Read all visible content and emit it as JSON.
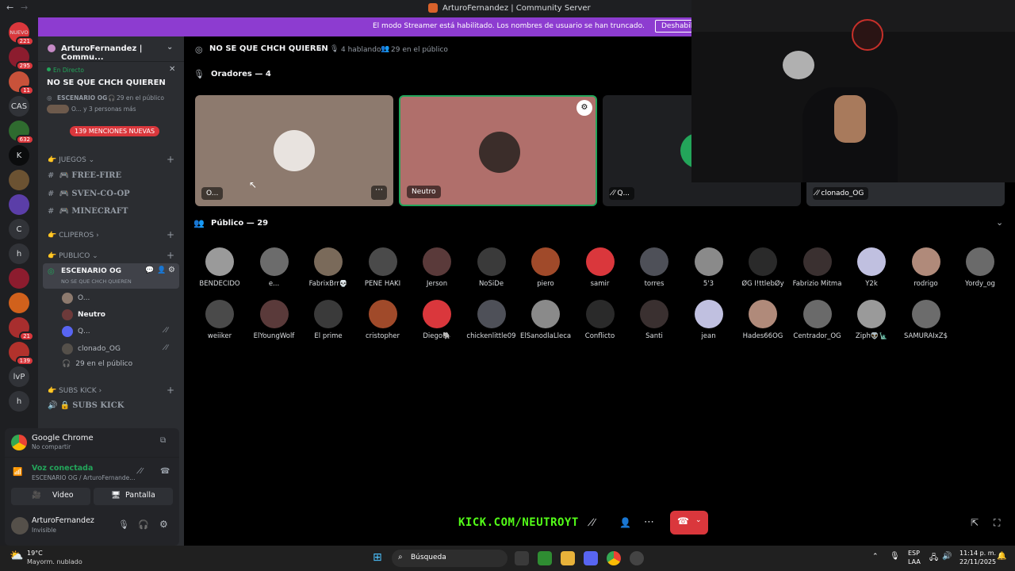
{
  "window": {
    "title": "ArturoFernandez | Community Server"
  },
  "banner": {
    "text": "El modo Streamer está habilitado. Los nombres de usuario se han truncado.",
    "button": "Deshabilitar"
  },
  "rail": {
    "items": [
      {
        "label": "NUEVO",
        "badge": "221",
        "color": "#da373c"
      },
      {
        "label": "",
        "badge": "295",
        "color": "#8c1c2e"
      },
      {
        "label": "",
        "badge": "11",
        "color": "#c8523a"
      },
      {
        "label": "CAS",
        "badge": "",
        "color": "#313338"
      },
      {
        "label": "",
        "badge": "632",
        "color": "#2f6b2f"
      },
      {
        "label": "K",
        "badge": "",
        "color": "#0b0c0d"
      },
      {
        "label": "",
        "badge": "",
        "color": "#6b5232"
      },
      {
        "label": "",
        "badge": "",
        "color": "#5b3ea8"
      },
      {
        "label": "C",
        "badge": "",
        "color": "#313338"
      },
      {
        "label": "h",
        "badge": "",
        "color": "#313338"
      },
      {
        "label": "",
        "badge": "",
        "color": "#8c1c2e"
      },
      {
        "label": "",
        "badge": "",
        "color": "#d1611c"
      },
      {
        "label": "",
        "badge": "21",
        "color": "#a82e2e"
      },
      {
        "label": "",
        "badge": "139",
        "color": "#b2322c"
      },
      {
        "label": "lvP",
        "badge": "",
        "color": "#313338"
      },
      {
        "label": "h",
        "badge": "",
        "color": "#313338"
      }
    ]
  },
  "sidebar": {
    "server_name": "ArturoFernandez | Commu...",
    "live": {
      "status": "En Directo",
      "title": "NO SE QUE CHCH QUIEREN",
      "stage": "ESCENARIO OG",
      "audience": "29 en el público",
      "others": "O... y 3 personas más"
    },
    "mentions_badge": "139 MENCIONES NUEVAS",
    "categories": [
      {
        "name": "JUEGOS",
        "channels": [
          "FREE-FIRE",
          "SVEN-CO-OP",
          "MINECRAFT"
        ]
      },
      {
        "name": "CLIPEROS",
        "channels": []
      },
      {
        "name": "PUBLICO",
        "channels": []
      }
    ],
    "stage_channel": {
      "name": "ESCENARIO OG",
      "topic": "NO SE QUE CHCH QUIEREN"
    },
    "stage_users": [
      "O...",
      "Neutro",
      "Q...",
      "clonado_OG"
    ],
    "stage_audience": "29 en el público",
    "subs_category": "SUBS KICK",
    "subs_channel": "SUBS KICK"
  },
  "activity": {
    "app": "Google Chrome",
    "status": "No compartir"
  },
  "voice": {
    "status": "Voz conectada",
    "location": "ESCENARIO OG / ArturoFernande...",
    "video_btn": "Video",
    "screen_btn": "Pantalla"
  },
  "user": {
    "name": "ArturoFernandez",
    "status": "Invisible"
  },
  "main": {
    "stage_title": "NO SE QUE CHCH QUIEREN",
    "speaking": "4 hablando",
    "public_count": "29 en el público",
    "speakers_header": "Oradores — 4",
    "speakers": [
      {
        "name": "O...",
        "bg": "#8d7a6e"
      },
      {
        "name": "Neutro",
        "bg": "#b06f6b"
      },
      {
        "name": "Q...",
        "bg": "#1e1f22"
      },
      {
        "name": "clonado_OG",
        "bg": "#2b2d31"
      }
    ],
    "public_header": "Público — 29",
    "audience_row1": [
      "BENDECIDO",
      "e...",
      "FabrixBrr💀",
      "PENE HAKI",
      "Jerson",
      "NoSiDe",
      "piero",
      "samir",
      "torres",
      "5'3",
      "ØG I!ttlebØy",
      "Fabrizio Mitma",
      "Y2k",
      "rodrigo",
      "Yordy_og"
    ],
    "audience_row2": [
      "weiiker",
      "ElYoungWolf",
      "El prime",
      "cristopher",
      "Diego🐘",
      "chickenlittle09",
      "ElSanodlaLleca",
      "Conflicto",
      "Santi",
      "jean",
      "Hades66OG",
      "Centrador_OG",
      "Ziph👽🗽",
      "SAMURAIxZ$"
    ]
  },
  "overlay": {
    "text": "KICK.COM/NEUTROYT"
  },
  "taskbar": {
    "weather_temp": "19°C",
    "weather_desc": "Mayorm. nublado",
    "search": "Búsqueda",
    "lang": "ESP",
    "lang2": "LAA",
    "time": "11:14 p. m.",
    "date": "22/11/2025"
  },
  "colors": {
    "accent": "#5865f2",
    "banner": "#8d3cd0",
    "danger": "#da373c",
    "green": "#23a55a"
  }
}
